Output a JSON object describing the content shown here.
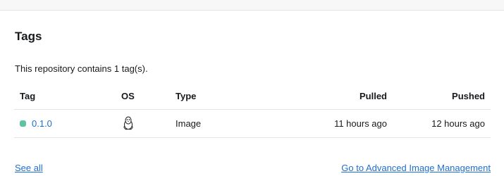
{
  "section": {
    "title": "Tags",
    "summary": "This repository contains 1 tag(s)."
  },
  "table": {
    "headers": {
      "tag": "Tag",
      "os": "OS",
      "type": "Type",
      "pulled": "Pulled",
      "pushed": "Pushed"
    },
    "rows": [
      {
        "tag": "0.1.0",
        "os_icon": "linux-icon",
        "type": "Image",
        "pulled": "11 hours ago",
        "pushed": "12 hours ago"
      }
    ]
  },
  "footer": {
    "see_all": "See all",
    "advanced": "Go to Advanced Image Management"
  },
  "colors": {
    "link": "#1f6fd1",
    "status_dot": "#5fc3a0",
    "border": "#e2e4e8"
  }
}
